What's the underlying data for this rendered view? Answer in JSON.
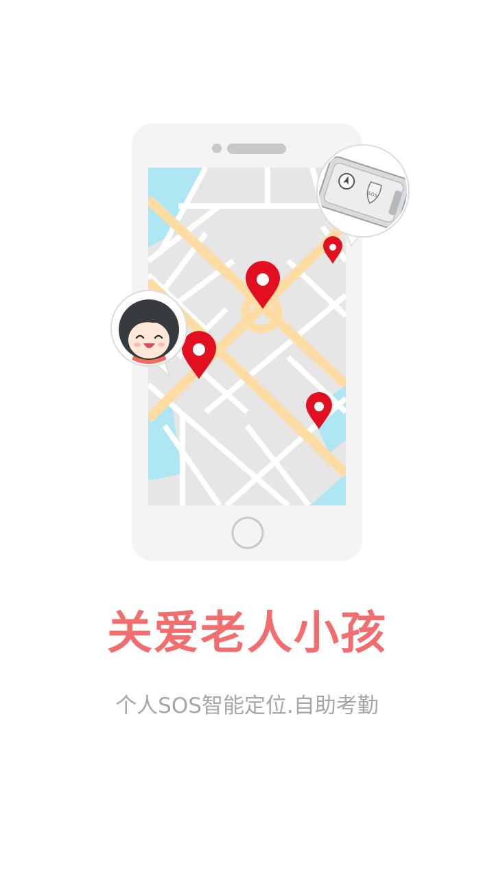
{
  "splash": {
    "title": "关爱老人小孩",
    "subtitle": "个人SOS智能定位.自助考勤"
  },
  "device_badge": {
    "label": "SOS"
  },
  "colors": {
    "title": "#f26d6d",
    "subtitle": "#a6a6a6",
    "pin": "#e10f1f",
    "road_major": "#ffdca4",
    "water": "#aee7f3",
    "map_bg": "#e6e6e6",
    "phone_body": "#f4f4f4"
  },
  "icons": {
    "pins": "map-pin-icon",
    "avatar": "girl-avatar-icon",
    "device": "gps-tracker-device-icon",
    "home_button": "home-button-icon"
  }
}
